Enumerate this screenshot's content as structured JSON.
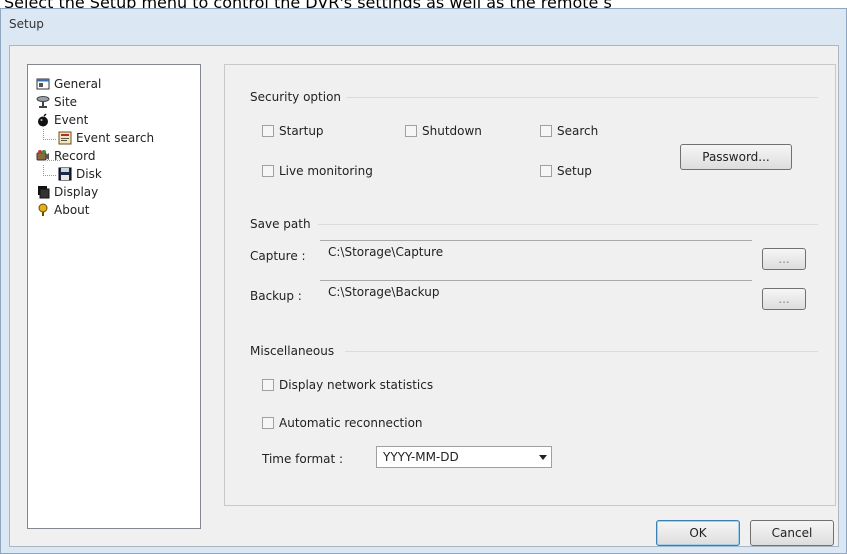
{
  "page_caption": "Select the Setup menu to control the DVR's settings as well as the remote s",
  "window": {
    "title": "Setup"
  },
  "tree": {
    "items": [
      {
        "label": "General",
        "icon": "general-icon"
      },
      {
        "label": "Site",
        "icon": "site-icon"
      },
      {
        "label": "Event",
        "icon": "event-icon"
      },
      {
        "label": "Event search",
        "icon": "event-search-icon"
      },
      {
        "label": "Record",
        "icon": "record-icon"
      },
      {
        "label": "Disk",
        "icon": "disk-icon"
      },
      {
        "label": "Display",
        "icon": "display-icon"
      },
      {
        "label": "About",
        "icon": "about-icon"
      }
    ]
  },
  "security": {
    "title": "Security option",
    "startup": "Startup",
    "shutdown": "Shutdown",
    "search": "Search",
    "live_monitoring": "Live monitoring",
    "setup": "Setup",
    "password_button": "Password..."
  },
  "save_path": {
    "title": "Save path",
    "capture_label": "Capture :",
    "capture_value": "C:\\Storage\\Capture",
    "backup_label": "Backup :",
    "backup_value": "C:\\Storage\\Backup",
    "browse_label": "..."
  },
  "misc": {
    "title": "Miscellaneous",
    "display_network_statistics": "Display network statistics",
    "automatic_reconnection": "Automatic reconnection",
    "time_format_label": "Time format :",
    "time_format_value": "YYYY-MM-DD"
  },
  "footer": {
    "ok": "OK",
    "cancel": "Cancel"
  }
}
